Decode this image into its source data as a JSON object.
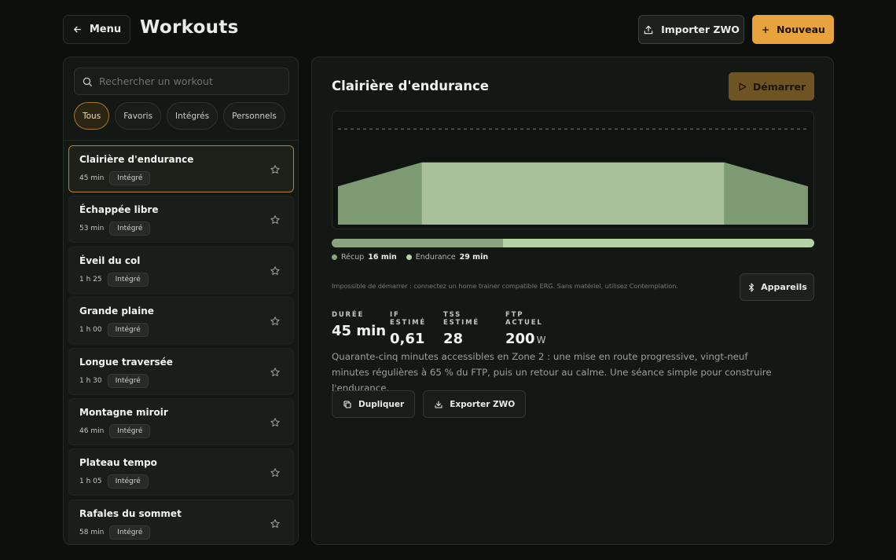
{
  "header": {
    "menu_label": "Menu",
    "title": "Workouts",
    "import_label": "Importer ZWO",
    "new_label": "Nouveau",
    "colors": {
      "accent": "#e8a23e",
      "background": "#0c0f0c"
    }
  },
  "search": {
    "placeholder": "Rechercher un workout",
    "value": ""
  },
  "filters": [
    {
      "label": "Tous",
      "active": true
    },
    {
      "label": "Favoris",
      "active": false
    },
    {
      "label": "Intégrés",
      "active": false
    },
    {
      "label": "Personnels",
      "active": false
    }
  ],
  "workouts": [
    {
      "title": "Clairière d'endurance",
      "duration": "45 min",
      "badge": "Intégré",
      "selected": true
    },
    {
      "title": "Échappée libre",
      "duration": "53 min",
      "badge": "Intégré",
      "selected": false
    },
    {
      "title": "Éveil du col",
      "duration": "1 h 25",
      "badge": "Intégré",
      "selected": false
    },
    {
      "title": "Grande plaine",
      "duration": "1 h 00",
      "badge": "Intégré",
      "selected": false
    },
    {
      "title": "Longue traversée",
      "duration": "1 h 30",
      "badge": "Intégré",
      "selected": false
    },
    {
      "title": "Montagne miroir",
      "duration": "46 min",
      "badge": "Intégré",
      "selected": false
    },
    {
      "title": "Plateau tempo",
      "duration": "1 h 05",
      "badge": "Intégré",
      "selected": false
    },
    {
      "title": "Rafales du sommet",
      "duration": "58 min",
      "badge": "Intégré",
      "selected": false
    }
  ],
  "detail": {
    "title": "Clairière d'endurance",
    "start_label": "Démarrer",
    "profile": {
      "ftp_line": 1.0,
      "segments": [
        {
          "type": "ramp",
          "from": 0.4,
          "to": 0.65,
          "minutes": 8
        },
        {
          "type": "steady",
          "power": 0.65,
          "minutes": 29
        },
        {
          "type": "ramp",
          "from": 0.65,
          "to": 0.4,
          "minutes": 8
        }
      ]
    },
    "zones": [
      {
        "name": "Récup",
        "minutes_label": "16 min",
        "minutes": 16,
        "color": "#8aa57e"
      },
      {
        "name": "Endurance",
        "minutes_label": "29 min",
        "minutes": 29,
        "color": "#b5d2a6"
      }
    ],
    "warning": "Impossible de démarrer : connectez un home trainer compatible ERG. Sans matériel, utilisez Contemplation.",
    "devices_label": "Appareils",
    "stats": [
      {
        "label": "DURÉE",
        "value": "45 min",
        "unit": ""
      },
      {
        "label": "IF ESTIMÉ",
        "value": "0,61",
        "unit": ""
      },
      {
        "label": "TSS ESTIMÉ",
        "value": "28",
        "unit": ""
      },
      {
        "label": "FTP ACTUEL",
        "value": "200",
        "unit": "W"
      }
    ],
    "description": "Quarante-cinq minutes accessibles en Zone 2 : une mise en route progressive, vingt-neuf minutes régulières à 65 % du FTP, puis un retour au calme. Une séance simple pour construire l'endurance.",
    "duplicate_label": "Dupliquer",
    "export_label": "Exporter ZWO"
  }
}
